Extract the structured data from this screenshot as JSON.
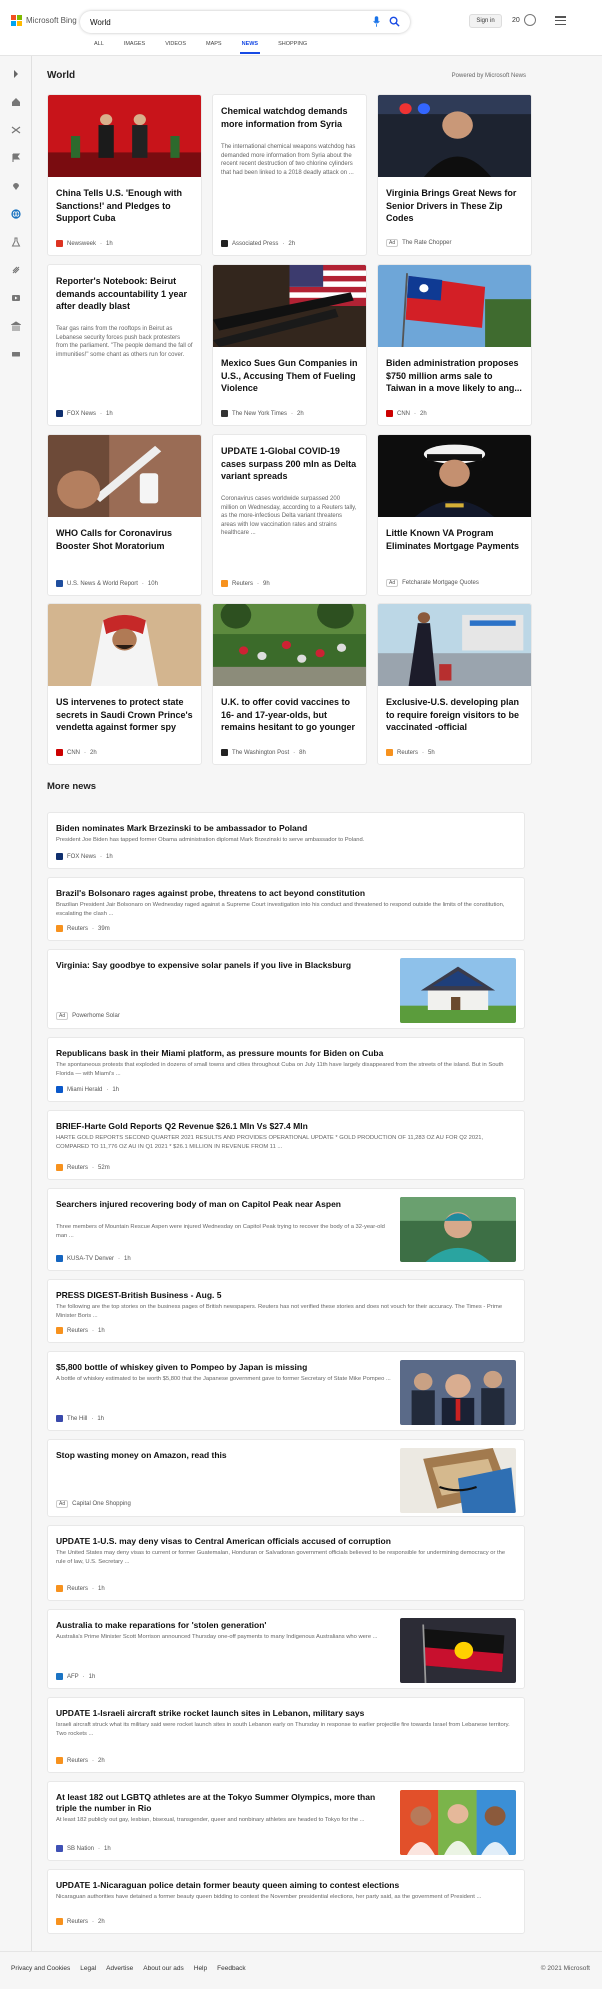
{
  "header": {
    "brand": "Microsoft Bing",
    "search_value": "World",
    "tabs": [
      "ALL",
      "IMAGES",
      "VIDEOS",
      "MAPS",
      "NEWS",
      "SHOPPING"
    ],
    "active_tab": "NEWS",
    "signin_label": "Sign in",
    "rewards_points": "20"
  },
  "section": {
    "title": "World",
    "powered_by": "Powered by Microsoft News"
  },
  "cards": [
    {
      "title": "China Tells U.S. 'Enough with Sanctions!' and Pledges to Support Cuba",
      "snippet": "",
      "source": "Newsweek",
      "time": "1h",
      "is_ad": false,
      "image": "china-us-meeting"
    },
    {
      "title": "Chemical watchdog demands more information from Syria",
      "snippet": "The international chemical weapons watchdog has demanded more information from Syria about the recent recent destruction of two chlorine cylinders that had been linked to a 2018 deadly attack on ...",
      "source": "Associated Press",
      "time": "2h",
      "is_ad": false,
      "image": ""
    },
    {
      "title": "Virginia Brings Great News for Senior Drivers in These Zip Codes",
      "snippet": "",
      "source": "The Rate Chopper",
      "time": "",
      "is_ad": true,
      "image": "police-officer"
    },
    {
      "title": "Reporter's Notebook: Beirut demands accountability 1 year after deadly blast",
      "snippet": "Tear gas rains from the rooftops in Beirut as Lebanese security forces push back protesters from the parliament. \"The people demand the fall of immunities!\" some chant as others run for cover.",
      "source": "FOX News",
      "time": "1h",
      "is_ad": false,
      "image": ""
    },
    {
      "title": "Mexico Sues Gun Companies in U.S., Accusing Them of Fueling Violence",
      "snippet": "",
      "source": "The New York Times",
      "time": "2h",
      "is_ad": false,
      "image": "guns-flag"
    },
    {
      "title": "Biden administration proposes $750 million arms sale to Taiwan in a move likely to ang...",
      "snippet": "",
      "source": "CNN",
      "time": "2h",
      "is_ad": false,
      "image": "taiwan-flag"
    },
    {
      "title": "WHO Calls for Coronavirus Booster Shot Moratorium",
      "snippet": "",
      "source": "U.S. News & World Report",
      "time": "10h",
      "is_ad": false,
      "image": "vaccine-syringe"
    },
    {
      "title": "UPDATE 1-Global COVID-19 cases surpass 200 mln as Delta variant spreads",
      "snippet": "Coronavirus cases worldwide surpassed 200 million on Wednesday, according to a Reuters tally, as the more-infectious Delta variant threatens areas with low vaccination rates and strains healthcare ...",
      "source": "Reuters",
      "time": "9h",
      "is_ad": false,
      "image": ""
    },
    {
      "title": "Little Known VA Program Eliminates Mortgage Payments",
      "snippet": "",
      "source": "Fetcharate Mortgage Quotes",
      "time": "",
      "is_ad": true,
      "image": "navy-officer"
    },
    {
      "title": "US intervenes to protect state secrets in Saudi Crown Prince's vendetta against former spy",
      "snippet": "",
      "source": "CNN",
      "time": "2h",
      "is_ad": false,
      "image": "saudi-prince"
    },
    {
      "title": "U.K. to offer covid vaccines to 16- and 17-year-olds, but remains hesitant to go younger",
      "snippet": "",
      "source": "The Washington Post",
      "time": "8h",
      "is_ad": false,
      "image": "crowd-park"
    },
    {
      "title": "Exclusive-U.S. developing plan to require foreign visitors to be vaccinated -official",
      "snippet": "",
      "source": "Reuters",
      "time": "5h",
      "is_ad": false,
      "image": "airport"
    }
  ],
  "more_news": {
    "title": "More news",
    "items": [
      {
        "title": "Biden nominates Mark Brzezinski to be ambassador to Poland",
        "snippet": "President Joe Biden has tapped former Obama administration diplomat Mark Brzezinski to serve ambassador to Poland.",
        "source": "FOX News",
        "time": "1h",
        "is_ad": false,
        "image": ""
      },
      {
        "title": "Brazil's Bolsonaro rages against probe, threatens to act beyond constitution",
        "snippet": "Brazilian President Jair Bolsonaro on Wednesday raged against a Supreme Court investigation into his conduct and threatened to respond outside the limits of the constitution, escalating the clash ...",
        "source": "Reuters",
        "time": "39m",
        "is_ad": false,
        "image": ""
      },
      {
        "title": "Virginia: Say goodbye to expensive solar panels if you live in Blacksburg",
        "snippet": "",
        "source": "Powerhome Solar",
        "time": "",
        "is_ad": true,
        "image": "solar-house"
      },
      {
        "title": "Republicans bask in their Miami platform, as pressure mounts for Biden on Cuba",
        "snippet": "The spontaneous protests that exploded in dozens of small towns and cities throughout Cuba on July 11th have largely disappeared from the streets of the island. But in South Florida — with Miami's ...",
        "source": "Miami Herald",
        "time": "1h",
        "is_ad": false,
        "image": ""
      },
      {
        "title": "BRIEF-Harte Gold Reports Q2 Revenue $26.1 Mln Vs $27.4 Mln",
        "snippet": "HARTE GOLD REPORTS SECOND QUARTER 2021 RESULTS AND PROVIDES OPERATIONAL UPDATE * GOLD PRODUCTION OF 11,283 OZ AU FOR Q2 2021, COMPARED TO 11,776 OZ AU IN Q1 2021 * $26.1 MILLION IN REVENUE FROM 11 ...",
        "source": "Reuters",
        "time": "52m",
        "is_ad": false,
        "image": ""
      },
      {
        "title": "Searchers injured recovering body of man on Capitol Peak near Aspen",
        "snippet": "Three members of Mountain Rescue Aspen were injured Wednesday on Capitol Peak trying to recover the body of a 32-year-old man ...",
        "source": "KUSA-TV Denver",
        "time": "1h",
        "is_ad": false,
        "image": "man-mountain"
      },
      {
        "title": "PRESS DIGEST-British Business - Aug. 5",
        "snippet": "The following are the top stories on the business pages of British newspapers. Reuters has not verified these stories and does not vouch for their accuracy. The Times - Prime Minister Boris ...",
        "source": "Reuters",
        "time": "1h",
        "is_ad": false,
        "image": ""
      },
      {
        "title": "$5,800 bottle of whiskey given to Pompeo by Japan is missing",
        "snippet": "A bottle of whiskey estimated to be worth $5,800 that the Japanese government gave to former Secretary of State Mike Pompeo ...",
        "source": "The Hill",
        "time": "1h",
        "is_ad": false,
        "image": "pompeo"
      },
      {
        "title": "Stop wasting money on Amazon, read this",
        "snippet": "",
        "source": "Capital One Shopping",
        "time": "",
        "is_ad": true,
        "image": "amazon-boxes"
      },
      {
        "title": "UPDATE 1-U.S. may deny visas to Central American officials accused of corruption",
        "snippet": "The United States may deny visas to current or former Guatemalan, Honduran or Salvadoran government officials believed to be responsible for undermining democracy or the rule of law, U.S. Secretary ...",
        "source": "Reuters",
        "time": "1h",
        "is_ad": false,
        "image": ""
      },
      {
        "title": "Australia to make reparations for 'stolen generation'",
        "snippet": "Australia's Prime Minister Scott Morrison announced Thursday one-off payments to many Indigenous Australians who were ...",
        "source": "AFP",
        "time": "1h",
        "is_ad": false,
        "image": "aboriginal-flag"
      },
      {
        "title": "UPDATE 1-Israeli aircraft strike rocket launch sites in Lebanon, military says",
        "snippet": "Israeli aircraft struck what its military said were rocket launch sites in south Lebanon early on Thursday in response to earlier projectile fire towards Israel from Lebanese territory. Two rockets ...",
        "source": "Reuters",
        "time": "2h",
        "is_ad": false,
        "image": ""
      },
      {
        "title": "At least 182 out LGBTQ athletes are at the Tokyo Summer Olympics, more than triple the number in Rio",
        "snippet": "At least 182 publicly out gay, lesbian, bisexual, transgender, queer and nonbinary athletes are headed to Tokyo for the ...",
        "source": "SB Nation",
        "time": "1h",
        "is_ad": false,
        "image": "athletes"
      },
      {
        "title": "UPDATE 1-Nicaraguan police detain former beauty queen aiming to contest elections",
        "snippet": "Nicaraguan authorities have detained a former beauty queen bidding to contest the November presidential elections, her party said, as the government of President ...",
        "source": "Reuters",
        "time": "2h",
        "is_ad": false,
        "image": ""
      }
    ]
  },
  "footer": {
    "links": [
      "Privacy and Cookies",
      "Legal",
      "Advertise",
      "About our ads",
      "Help",
      "Feedback"
    ],
    "copyright": "© 2021 Microsoft"
  },
  "sidebar_icons": [
    "expand-icon",
    "home-icon",
    "shuffle-icon",
    "flag-icon",
    "location-icon",
    "globe-icon",
    "science-icon",
    "rocket-icon",
    "video-icon",
    "bank-icon",
    "money-icon"
  ],
  "colors": {
    "accent": "#174ae4",
    "rail_active": "#0f6cbd"
  }
}
